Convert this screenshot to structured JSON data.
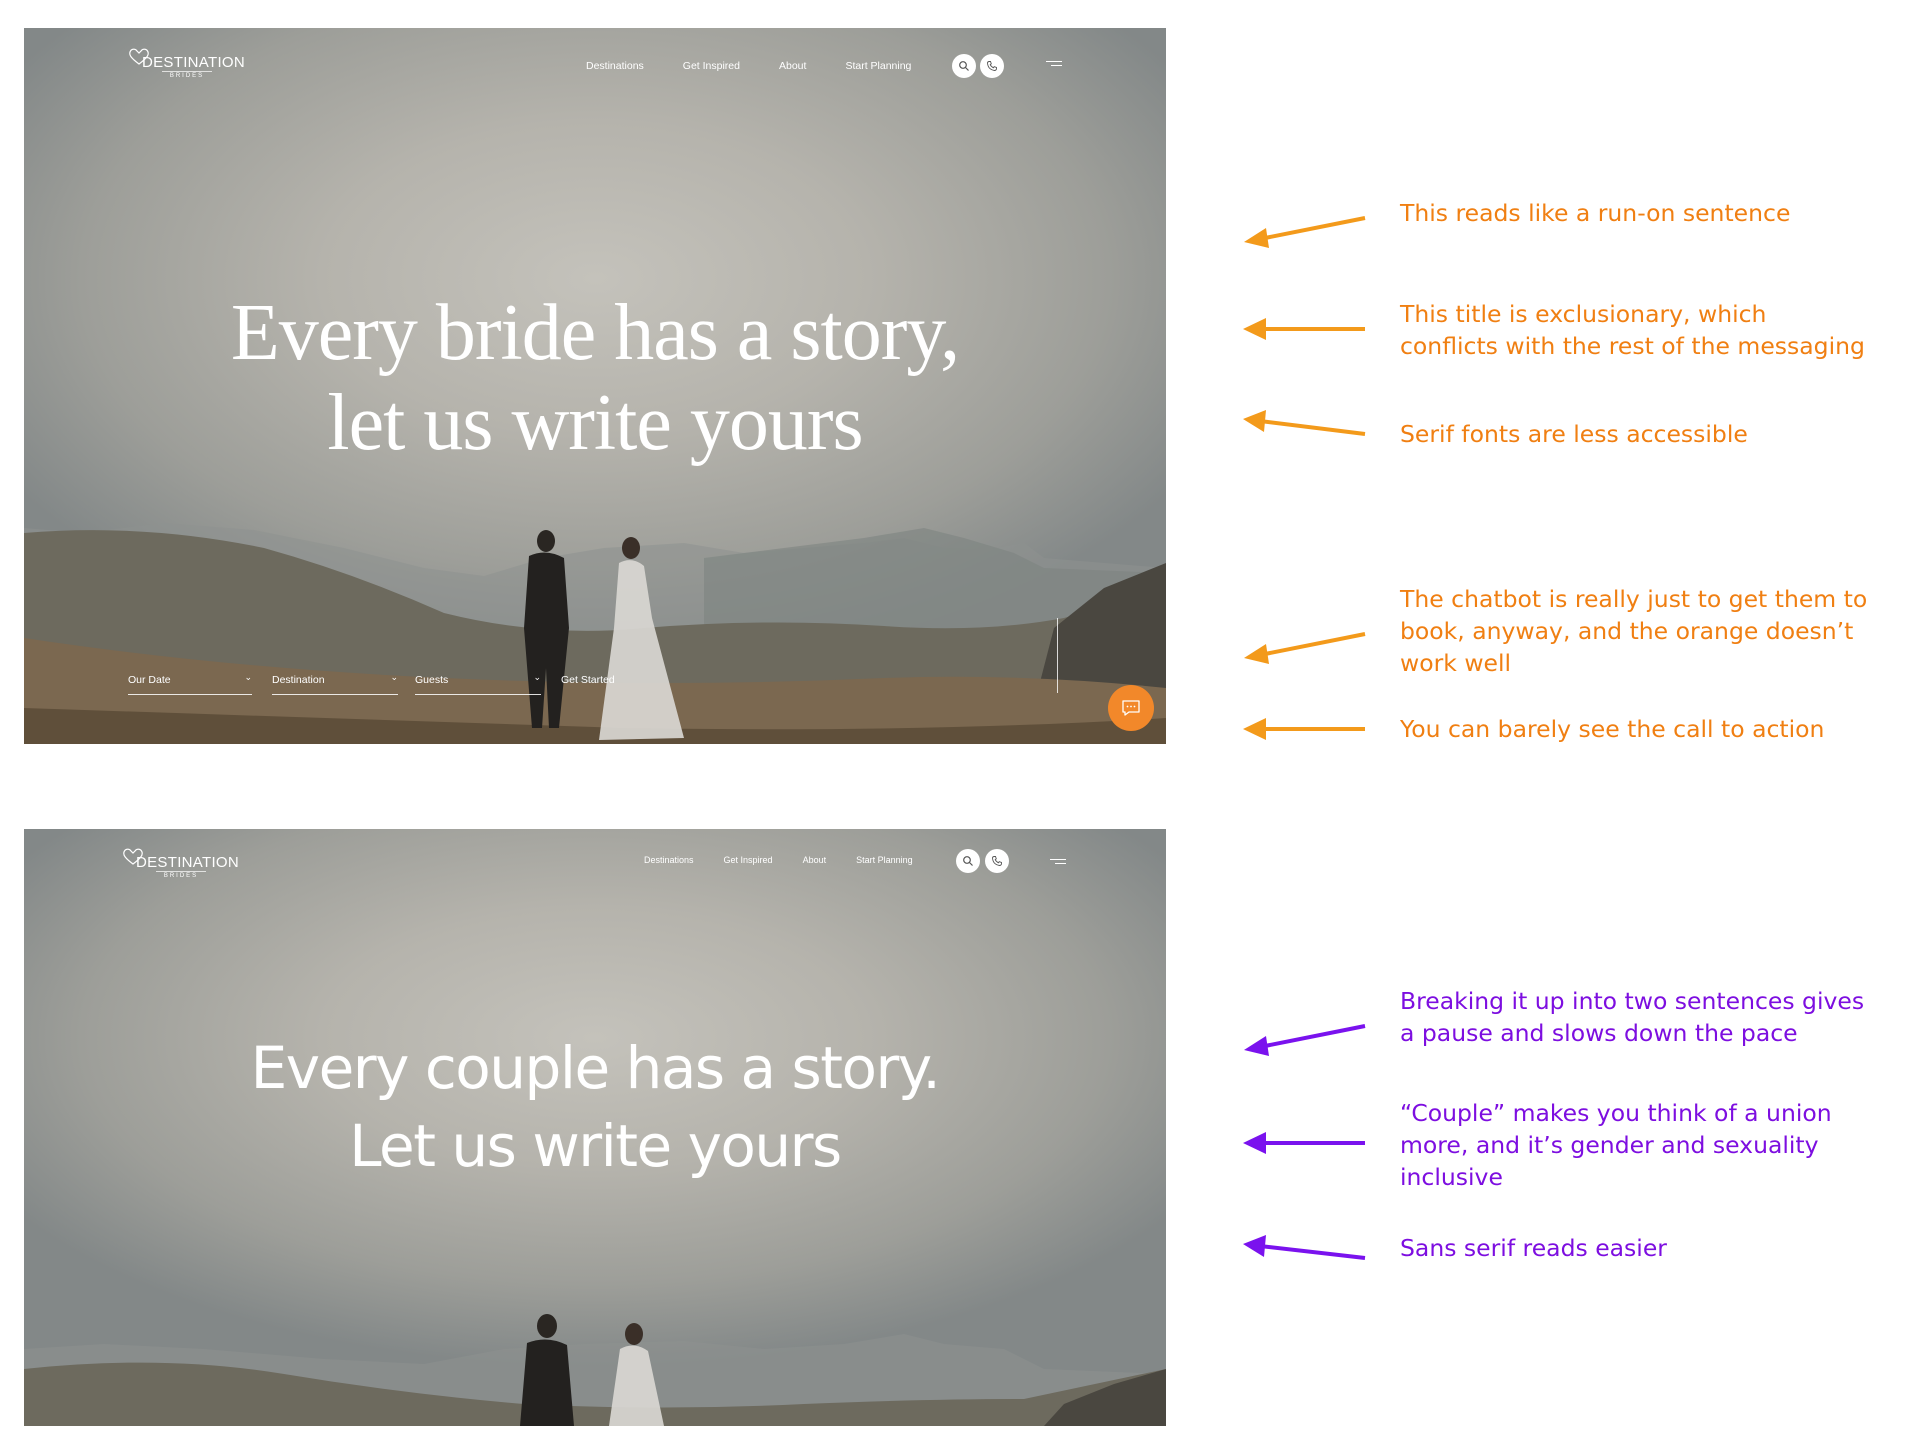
{
  "colors": {
    "orange_annotation": "#f07f12",
    "orange_arrow": "#f39a1b",
    "purple_annotation": "#7d0ee0",
    "purple_arrow": "#7a12ee",
    "chat_button": "#f2882a"
  },
  "before": {
    "logo": {
      "brand": "DESTINATION",
      "sub": "BRIDES",
      "icon": "heart-icon"
    },
    "nav": [
      "Destinations",
      "Get Inspired",
      "About",
      "Start Planning"
    ],
    "icons": [
      "search-icon",
      "phone-icon",
      "menu-icon"
    ],
    "hero": {
      "line1": "Every bride has a story,",
      "line2": "let us write yours"
    },
    "booking": {
      "our_date": "Our Date",
      "destination": "Destination",
      "guests": "Guests",
      "cta": "Get Started"
    },
    "chat_icon": "chat-icon"
  },
  "after": {
    "logo": {
      "brand": "DESTINATION",
      "sub": "BRIDES",
      "icon": "heart-icon"
    },
    "nav": [
      "Destinations",
      "Get Inspired",
      "About",
      "Start Planning"
    ],
    "icons": [
      "search-icon",
      "phone-icon",
      "menu-icon"
    ],
    "hero": {
      "line1": "Every couple has a story.",
      "line2": "Let us write yours"
    }
  },
  "annotations_before": [
    {
      "lines": [
        "This reads like a run-on sentence"
      ]
    },
    {
      "lines": [
        "This title is exclusionary, which",
        "conflicts with the rest of the messaging"
      ]
    },
    {
      "lines": [
        "Serif fonts are less accessible"
      ]
    },
    {
      "lines": [
        "The chatbot is really just to get them to",
        "book, anyway, and the orange doesn’t",
        "work well"
      ]
    },
    {
      "lines": [
        "You can barely see the call to action"
      ]
    }
  ],
  "annotations_after": [
    {
      "lines": [
        "Breaking it up into two sentences gives",
        "a pause and slows down the pace"
      ]
    },
    {
      "lines": [
        "“Couple” makes you think of a union",
        "more, and it’s gender and sexuality",
        "inclusive"
      ]
    },
    {
      "lines": [
        "Sans serif reads easier"
      ]
    }
  ]
}
